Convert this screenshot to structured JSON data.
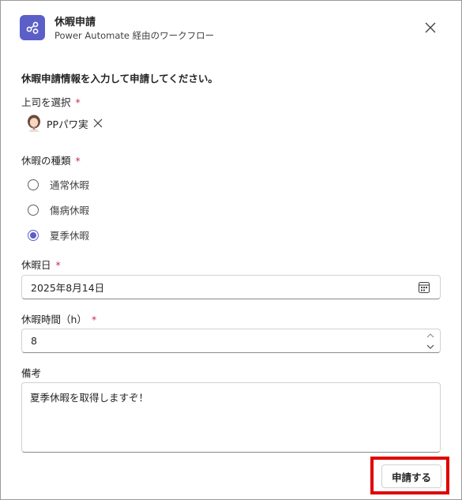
{
  "header": {
    "title": "休暇申請",
    "subtitle": "Power Automate 経由のワークフロー",
    "app_icon": "share-nodes-icon",
    "close_icon": "close-icon"
  },
  "form": {
    "instruction": "休暇申請情報を入力して申請してください。",
    "required_mark": "*",
    "supervisor": {
      "label": "上司を選択",
      "selected_name": "PPパワ実",
      "remove_icon": "close-icon"
    },
    "leave_type": {
      "label": "休暇の種類",
      "options": [
        {
          "label": "通常休暇",
          "checked": false
        },
        {
          "label": "傷病休暇",
          "checked": false
        },
        {
          "label": "夏季休暇",
          "checked": true
        }
      ]
    },
    "date": {
      "label": "休暇日",
      "value": "2025年8月14日",
      "icon": "calendar-icon"
    },
    "hours": {
      "label": "休暇時間（h）",
      "value": "8"
    },
    "remarks": {
      "label": "備考",
      "value": "夏季休暇を取得しますぞ！"
    },
    "submit_label": "申請する"
  },
  "colors": {
    "accent": "#5b5fc7",
    "required": "#c4314b",
    "highlight": "#e00000"
  }
}
